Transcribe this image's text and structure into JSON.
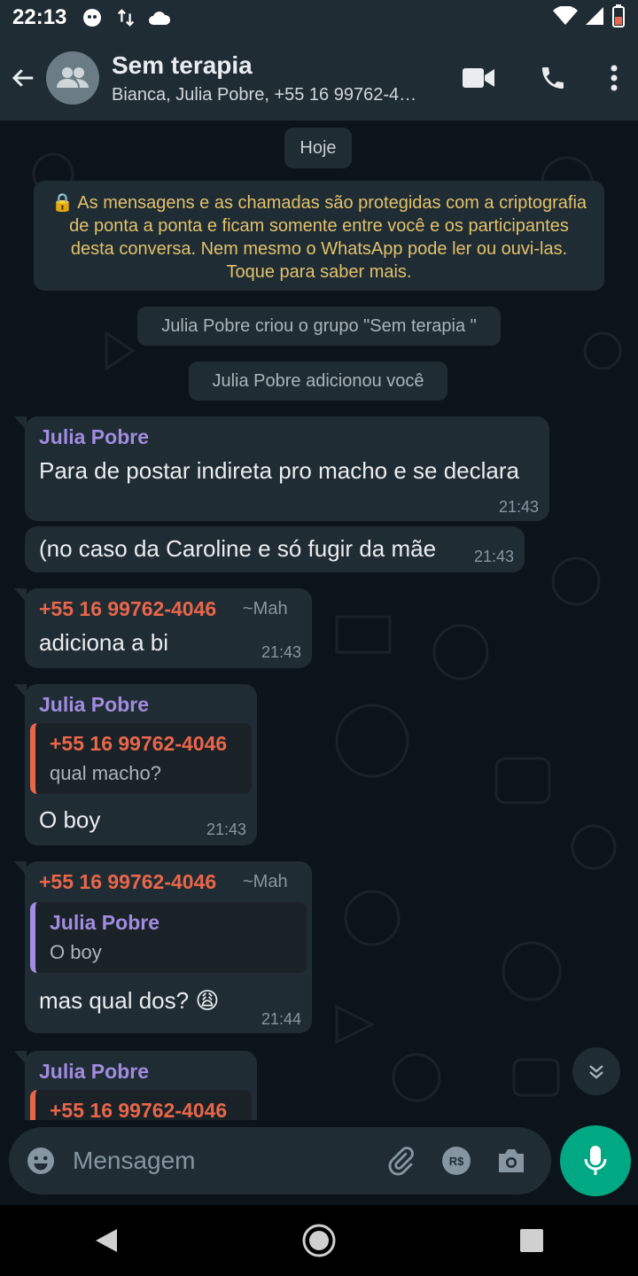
{
  "status": {
    "time": "22:13"
  },
  "header": {
    "title": "Sem terapia",
    "subtitle": "Bianca, Julia Pobre, +55 16 99762-4…"
  },
  "chat": {
    "day_chip": "Hoje",
    "encryption_notice": "🔒 As mensagens e as chamadas são protegidas com a criptografia de ponta a ponta e ficam somente entre você e os participantes desta conversa. Nem mesmo o WhatsApp pode ler ou ouvi-las. Toque para saber mais.",
    "system_messages": [
      "Julia Pobre criou o grupo \"Sem terapia \"",
      "Julia Pobre adicionou você"
    ],
    "messages": [
      {
        "sender": "Julia Pobre",
        "text": "Para de postar indireta pro macho e se declara",
        "time": "21:43"
      },
      {
        "text": "(no caso da Caroline e só fugir da mãe",
        "time": "21:43"
      },
      {
        "sender": "+55 16 99762-4046",
        "pushname": "~Mah",
        "text": "adiciona a bi",
        "time": "21:43"
      },
      {
        "sender": "Julia Pobre",
        "quote_sender": "+55 16 99762-4046",
        "quote_text": "qual macho?",
        "text": "O boy",
        "time": "21:43"
      },
      {
        "sender": "+55 16 99762-4046",
        "pushname": "~Mah",
        "quote_sender": "Julia Pobre",
        "quote_text": "O boy",
        "text": "mas qual dos? 😩",
        "time": "21:44"
      },
      {
        "sender": "Julia Pobre",
        "quote_sender": "+55 16 99762-4046"
      }
    ]
  },
  "composer": {
    "placeholder": "Mensagem"
  },
  "colors": {
    "accent": "#00a884",
    "julia": "#a08ce0",
    "number": "#e8664a",
    "bubble": "#202c33"
  }
}
